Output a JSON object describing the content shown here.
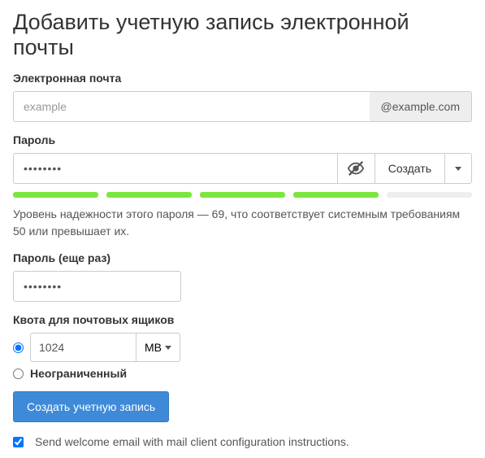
{
  "title": "Добавить учетную запись электронной почты",
  "email": {
    "label": "Электронная почта",
    "placeholder": "example",
    "domain": "@example.com"
  },
  "password": {
    "label": "Пароль",
    "value": "••••••••",
    "generate_label": "Создать",
    "strength_segments": 5,
    "strength_filled": 4,
    "strength_text": "Уровень надежности этого пароля — 69, что соответствует системным требованиям 50 или превышает их."
  },
  "password_confirm": {
    "label": "Пароль (еще раз)",
    "value": "••••••••"
  },
  "quota": {
    "label": "Квота для почтовых ящиков",
    "value": "1024",
    "unit": "MB",
    "unlimited_label": "Неограниченный"
  },
  "submit_label": "Создать учетную запись",
  "welcome_checkbox_label": "Send welcome email with mail client configuration instructions."
}
